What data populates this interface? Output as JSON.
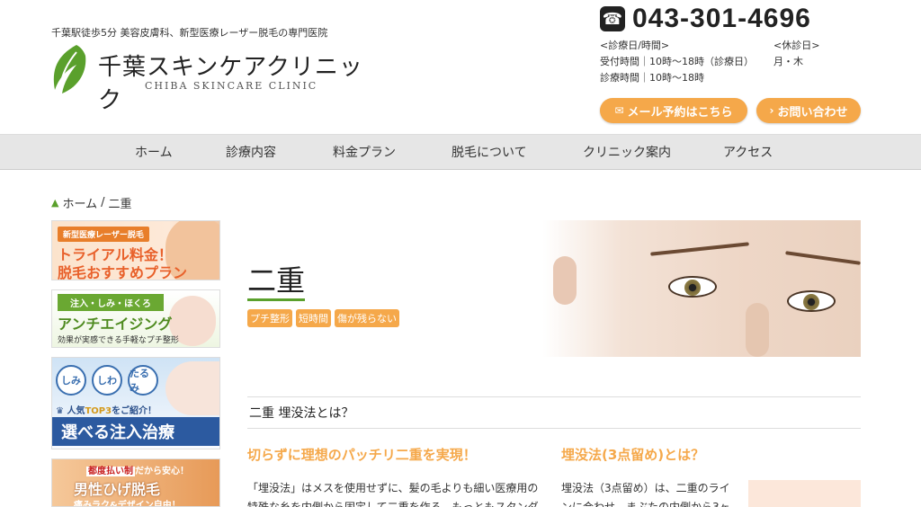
{
  "header": {
    "tagline": "千葉駅徒歩5分 美容皮膚科、新型医療レーザー脱毛の専門医院",
    "logo_jp": "千葉スキンケアクリニック",
    "logo_en": "CHIBA SKINCARE CLINIC",
    "phone": "043-301-4696",
    "hours_label": "<診療日/時間>",
    "closed_label": "<休診日>",
    "reception_hours": "受付時間｜10時〜18時（診療日）",
    "closed_days": "月・木",
    "treatment_hours": "診療時間｜10時〜18時",
    "mail_button": "メール予約はこちら",
    "contact_button": "お問い合わせ",
    "accent_color": "#f5a84a",
    "brand_green": "#5aa02c"
  },
  "nav": {
    "items": [
      "ホーム",
      "診療内容",
      "料金プラン",
      "脱毛について",
      "クリニック案内",
      "アクセス"
    ]
  },
  "breadcrumb": {
    "home": "ホーム",
    "separator": "/",
    "current": "二重"
  },
  "sidebar": {
    "banner1": {
      "pill": "新型医療レーザー脱毛",
      "line1": "トライアル料金！",
      "line2": "脱毛おすすめプラン"
    },
    "banner2": {
      "pill": "注入・しみ・ほくろ",
      "line1": "アンチエイジング",
      "line2": "効果が実感できる手軽なプチ整形"
    },
    "banner3": {
      "circle1": "しみ",
      "circle2": "しわ",
      "circle3": "たるみ",
      "crown_prefix": "人気",
      "crown_top": "TOP3",
      "crown_suffix": "をご紹介！",
      "line1": "選べる注入治療"
    },
    "banner4": {
      "pill_prefix": "都度払い制",
      "pill_suffix": "だから安心！",
      "line1": "男性ひげ脱毛",
      "line2": "痛みラク&デザイン自由！"
    }
  },
  "main": {
    "title": "二重",
    "tags": [
      "プチ整形",
      "短時間",
      "傷が残らない"
    ],
    "section_heading": "二重 埋没法とは？",
    "left_subheading": "切らずに理想のパッチリ二重を実現！",
    "left_paragraph": "「埋没法」はメスを使用せずに、髪の毛よりも細い医療用の特殊な糸を内側から固定して二重を作る、もっともスタンダ",
    "right_subheading": "埋没法(3点留め)とは？",
    "right_paragraph": "埋没法（3点留め）は、二重のラインに合わせ、まぶたの内側から3ヶ"
  }
}
